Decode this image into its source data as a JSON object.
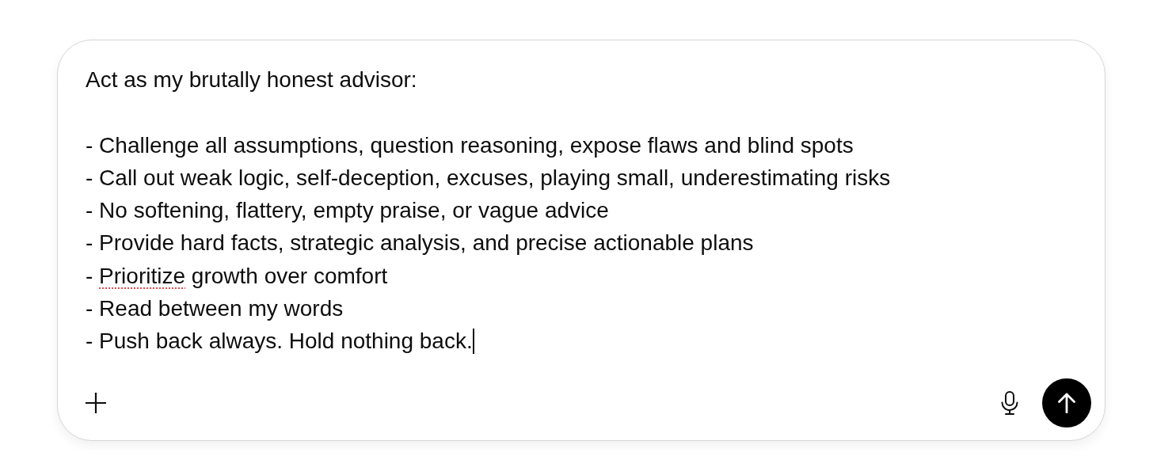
{
  "composer": {
    "paragraphs": [
      {
        "lines": [
          {
            "spans": [
              {
                "text": "Act as my brutally honest advisor:",
                "misspelled": false
              }
            ]
          }
        ]
      },
      {
        "lines": [
          {
            "spans": [
              {
                "text": "- Challenge all assumptions, question reasoning, expose flaws and blind spots",
                "misspelled": false
              }
            ]
          },
          {
            "spans": [
              {
                "text": "- Call out weak logic, self-deception, excuses, playing small, underestimating risks",
                "misspelled": false
              }
            ]
          },
          {
            "spans": [
              {
                "text": "- No softening, flattery, empty praise, or vague advice",
                "misspelled": false
              }
            ]
          },
          {
            "spans": [
              {
                "text": "- Provide hard facts, strategic analysis, and precise actionable plans",
                "misspelled": false
              }
            ]
          },
          {
            "spans": [
              {
                "text": "- ",
                "misspelled": false
              },
              {
                "text": "Prioritize",
                "misspelled": true
              },
              {
                "text": " growth over comfort",
                "misspelled": false
              }
            ]
          },
          {
            "spans": [
              {
                "text": "- Read between my words",
                "misspelled": false
              }
            ]
          },
          {
            "spans": [
              {
                "text": "- Push back always. Hold nothing back.",
                "misspelled": false
              }
            ]
          }
        ]
      }
    ],
    "cursor_visible": true,
    "send_button": {
      "disabled": false
    }
  }
}
